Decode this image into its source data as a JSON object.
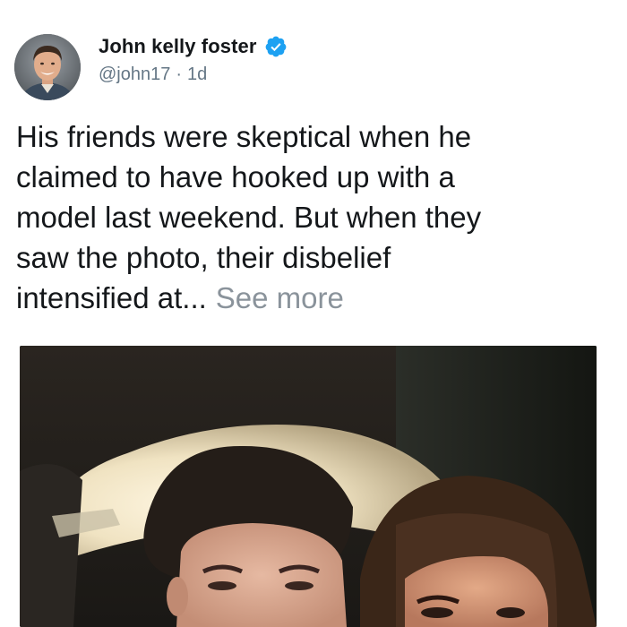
{
  "author": {
    "name": "John kelly foster",
    "handle": "@john17",
    "separator": "·",
    "time": "1d",
    "verified": true,
    "avatar_icon": "user-avatar"
  },
  "tweet": {
    "lines": [
      "His friends were skeptical when he",
      "claimed to have hooked up with a",
      "model last weekend. But when they",
      "saw the photo, their disbelief"
    ],
    "last_line": "intensified at...",
    "see_more": "See more"
  },
  "colors": {
    "text": "#14171a",
    "secondary": "#657786",
    "see_more": "#8a939b",
    "verified_badge": "#1da1f2"
  },
  "media": {
    "icon": "selfie-photo"
  }
}
